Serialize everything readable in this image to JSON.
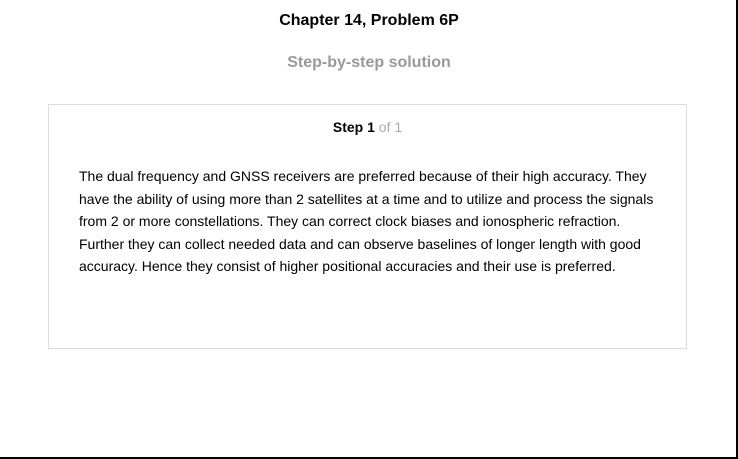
{
  "header": {
    "chapter_title": "Chapter 14, Problem 6P",
    "subtitle": "Step-by-step solution"
  },
  "step": {
    "label": "Step",
    "number": "1",
    "of_text": "of 1",
    "body": "The dual frequency and GNSS receivers are preferred because of their high accuracy. They have the ability of using more than 2 satellites at a time and to utilize and process the signals from 2 or more constellations. They can correct clock biases and ionospheric refraction. Further they can collect needed data and can observe baselines of longer length with good accuracy. Hence they consist of higher positional accuracies and their use is preferred."
  }
}
